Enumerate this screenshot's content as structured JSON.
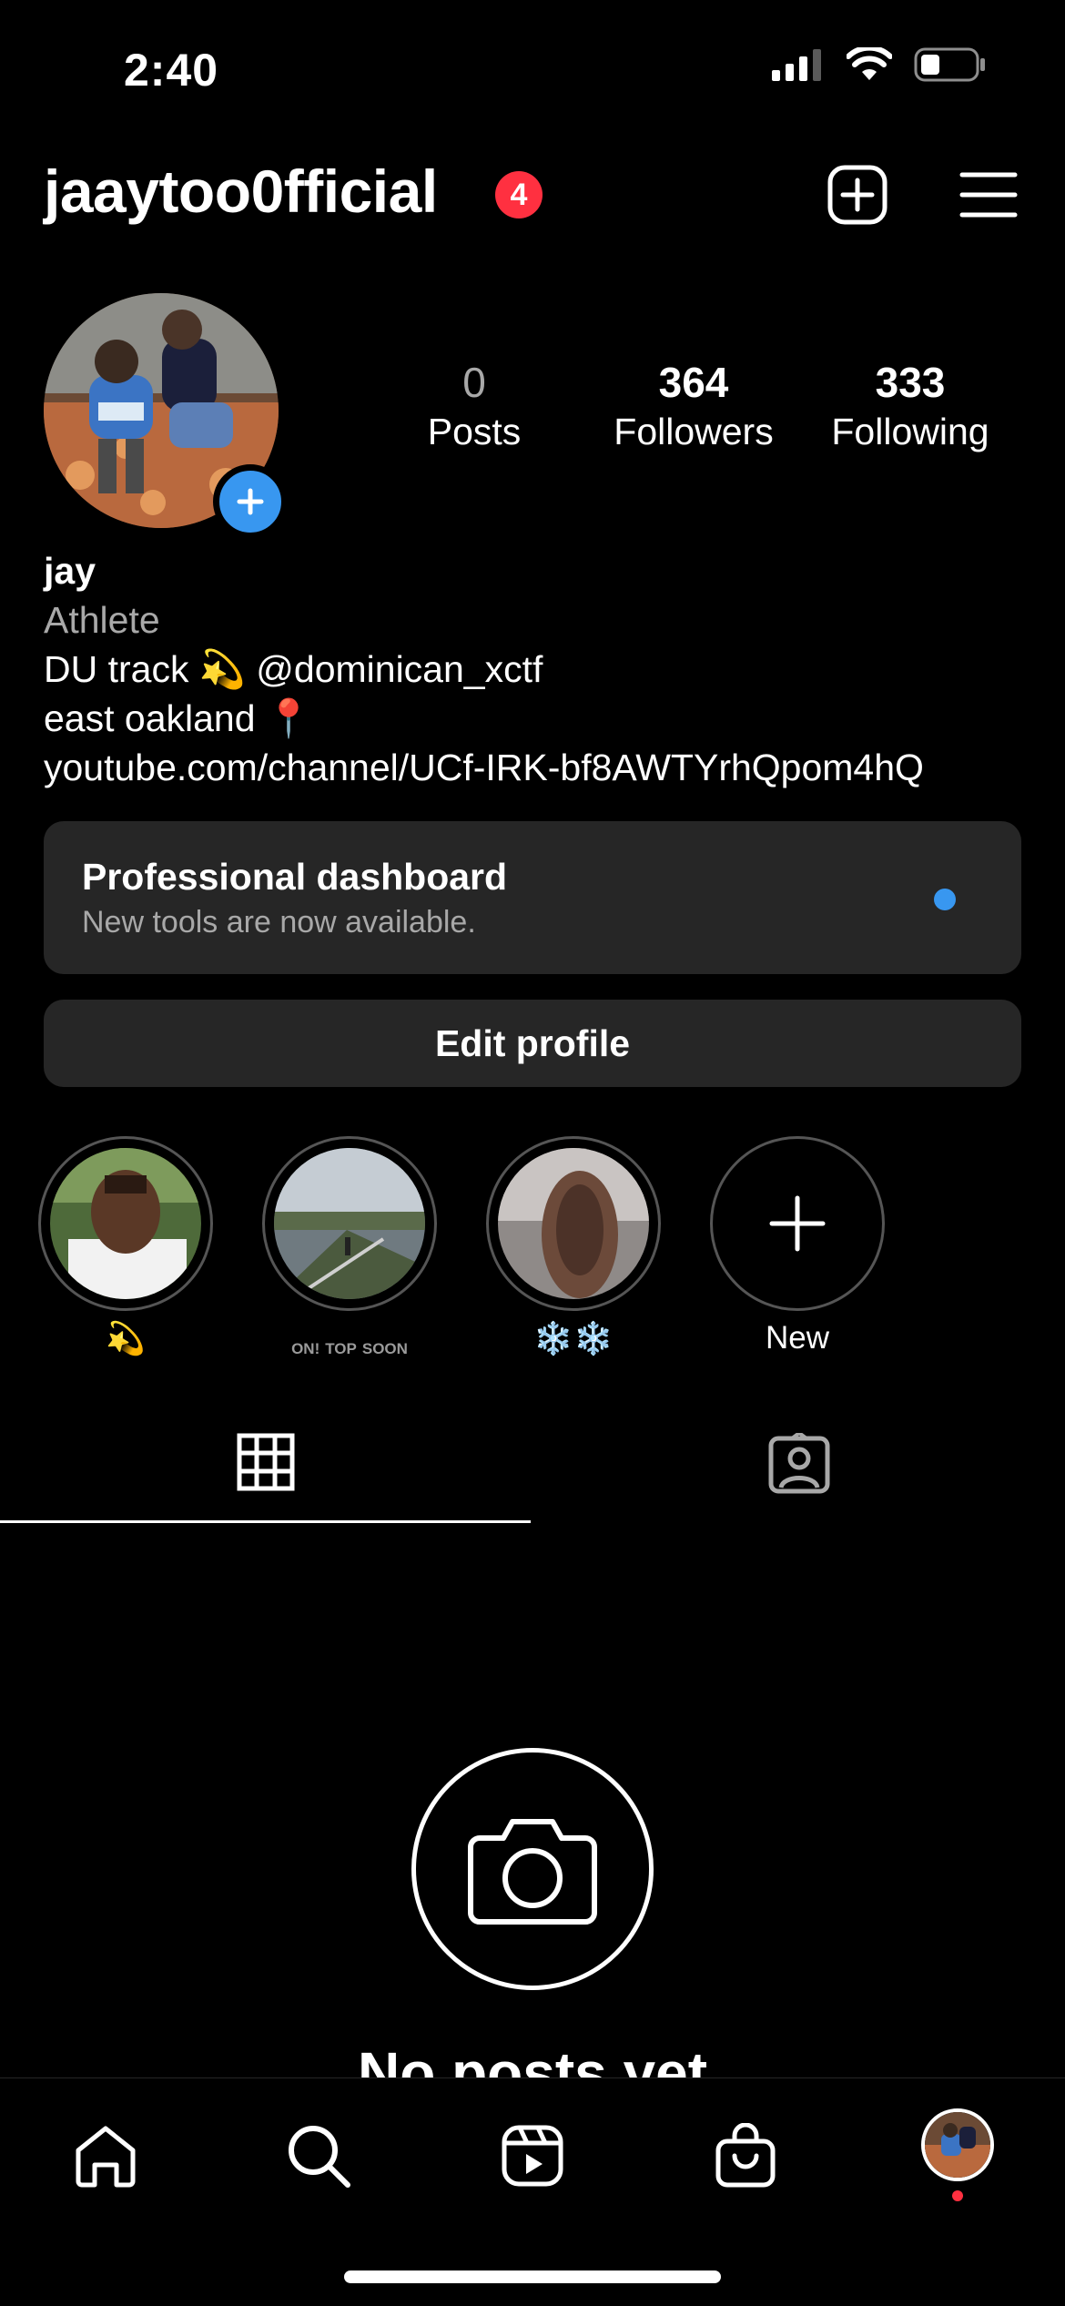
{
  "status_bar": {
    "time": "2:40"
  },
  "header": {
    "username": "jaaytoo0fficial",
    "notification_count": "4"
  },
  "profile": {
    "stats": [
      {
        "value": "0",
        "label": "Posts"
      },
      {
        "value": "364",
        "label": "Followers"
      },
      {
        "value": "333",
        "label": "Following"
      }
    ],
    "name": "jay",
    "category": "Athlete",
    "bio_lines": [
      "DU track 💫 @dominican_xctf",
      "east oakland 📍"
    ],
    "link": "youtube.com/channel/UCf-IRK-bf8AWTYrhQpom4hQ"
  },
  "dashboard": {
    "title": "Professional dashboard",
    "subtitle": "New tools are now available."
  },
  "edit_profile_label": "Edit profile",
  "highlights": [
    {
      "label": "💫"
    },
    {
      "label": ""
    },
    {
      "label": "❄️❄️"
    },
    {
      "label": "New"
    }
  ],
  "highlight_2_overlay": [
    "ON!",
    "TOP",
    "SOON"
  ],
  "empty_state": {
    "title": "No posts yet"
  },
  "colors": {
    "accent": "#3897f0",
    "badge": "#ff3040",
    "surface": "#262626",
    "muted": "#a8a8a8"
  },
  "icons": {
    "header": [
      "new-post-icon",
      "menu-icon"
    ],
    "tabs": [
      "grid-icon",
      "tagged-icon"
    ],
    "nav": [
      "home-icon",
      "search-icon",
      "reels-icon",
      "shop-icon",
      "profile-avatar"
    ]
  }
}
